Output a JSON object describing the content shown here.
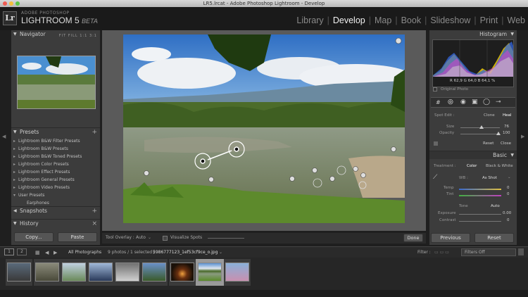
{
  "window": {
    "title": "LR5.lrcat - Adobe Photoshop Lightroom - Develop"
  },
  "identity": {
    "logo": "Lr",
    "line1": "ADOBE PHOTOSHOP",
    "line2": "LIGHTROOM 5",
    "beta": "BETA"
  },
  "modules": [
    "Library",
    "Develop",
    "Map",
    "Book",
    "Slideshow",
    "Print",
    "Web"
  ],
  "modules_active": "Develop",
  "left_panel": {
    "navigator": {
      "title": "Navigator",
      "zoom": "FIT  FILL  1:1  3:1"
    },
    "presets": {
      "title": "Presets",
      "items": [
        "Lightroom B&W Filter Presets",
        "Lightroom B&W Presets",
        "Lightroom B&W Toned Presets",
        "Lightroom Color Presets",
        "Lightroom Effect Presets",
        "Lightroom General Presets",
        "Lightroom Video Presets",
        "User Presets"
      ],
      "sub_items": [
        "Earphones"
      ]
    },
    "snapshots": {
      "title": "Snapshots"
    },
    "history": {
      "title": "History"
    },
    "copy_label": "Copy...",
    "paste_label": "Paste"
  },
  "toolbar": {
    "tool_overlay_label": "Tool Overlay :",
    "tool_overlay_value": "Auto",
    "visualize_label": "Visualize Spots",
    "done_label": "Done"
  },
  "right_panel": {
    "histogram": {
      "title": "Histogram",
      "readout": "R 62,9  G 64,0  B 64,1 %",
      "original_photo": "Original Photo"
    },
    "spot_edit": {
      "label": "Spot Edit :",
      "clone": "Clone",
      "heal": "Heal",
      "size_label": "Size",
      "size_value": "76",
      "opacity_label": "Opacity",
      "opacity_value": "100",
      "reset": "Reset",
      "close": "Close"
    },
    "basic": {
      "title": "Basic",
      "treatment_label": "Treatment :",
      "color": "Color",
      "bw": "Black & White",
      "wb_label": "WB :",
      "wb_value": "As Shot",
      "temp_label": "Temp",
      "temp_value": "0",
      "tint_label": "Tint",
      "tint_value": "0",
      "tone_label": "Tone",
      "auto": "Auto",
      "exposure_label": "Exposure",
      "exposure_value": "0.00",
      "contrast_label": "Contrast",
      "contrast_value": "0"
    },
    "previous_label": "Previous",
    "reset_label": "Reset"
  },
  "filmstrip": {
    "source": "All Photographs",
    "count": "9 photos / 1 selected /",
    "filename": "5986777123_1ef53cf9ce_o.jpg",
    "filter_label": "Filter :",
    "filter_value": "Filters Off",
    "page_1": "1",
    "page_2": "2"
  },
  "colors": {
    "panel_bg": "#3c3c3c",
    "chrome_bg": "#1a1a1a",
    "active_module": "#f0f0f0",
    "inactive_module": "#8a8a8a",
    "accent_yellow": "#e6c200"
  }
}
